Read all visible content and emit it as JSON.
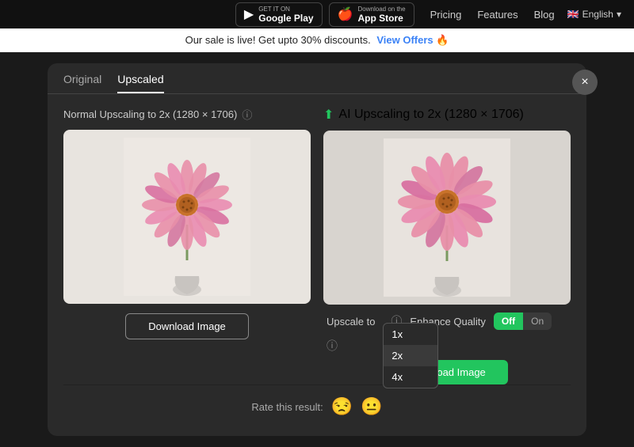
{
  "navbar": {
    "google_play_pre": "GET IT ON",
    "google_play_label": "Google Play",
    "app_store_pre": "Download on the",
    "app_store_label": "App Store",
    "nav_pricing": "Pricing",
    "nav_features": "Features",
    "nav_blog": "Blog",
    "nav_lang": "English"
  },
  "banner": {
    "text": "Our sale is live! Get upto 30% discounts.",
    "link_text": "View Offers 🔥"
  },
  "tabs": [
    {
      "label": "Original",
      "active": false
    },
    {
      "label": "Upscaled",
      "active": true
    }
  ],
  "left_panel": {
    "title": "Normal Upscaling to 2x (1280 × 1706)",
    "download_label": "Download Image"
  },
  "right_panel": {
    "title": "AI Upscaling to 2x (1280 × 1706)",
    "upscale_label": "Upscale to",
    "upscale_value": "2x",
    "upscale_options": [
      "1x",
      "2x",
      "4x"
    ],
    "enhance_label": "Enhance Quality",
    "toggle_on": "Off",
    "toggle_off": "On",
    "download_label": "Download Image"
  },
  "close_btn": "×",
  "rate_section": {
    "label": "Rate this result:",
    "emojis": [
      "😒",
      "😐"
    ]
  }
}
